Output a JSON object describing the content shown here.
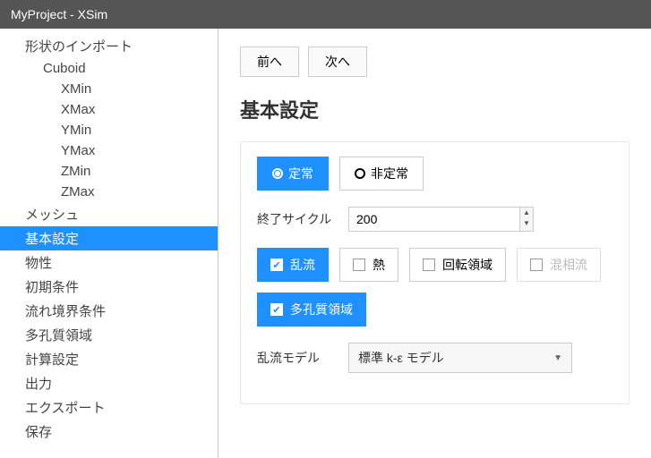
{
  "title": "MyProject - XSim",
  "sidebar": {
    "items": [
      {
        "label": "形状のインポート",
        "lvl": 0,
        "sel": false
      },
      {
        "label": "Cuboid",
        "lvl": 1,
        "sel": false
      },
      {
        "label": "XMin",
        "lvl": 2,
        "sel": false
      },
      {
        "label": "XMax",
        "lvl": 2,
        "sel": false
      },
      {
        "label": "YMin",
        "lvl": 2,
        "sel": false
      },
      {
        "label": "YMax",
        "lvl": 2,
        "sel": false
      },
      {
        "label": "ZMin",
        "lvl": 2,
        "sel": false
      },
      {
        "label": "ZMax",
        "lvl": 2,
        "sel": false
      },
      {
        "label": "メッシュ",
        "lvl": 0,
        "sel": false
      },
      {
        "label": "基本設定",
        "lvl": 0,
        "sel": true
      },
      {
        "label": "物性",
        "lvl": 0,
        "sel": false
      },
      {
        "label": "初期条件",
        "lvl": 0,
        "sel": false
      },
      {
        "label": "流れ境界条件",
        "lvl": 0,
        "sel": false
      },
      {
        "label": "多孔質領域",
        "lvl": 0,
        "sel": false
      },
      {
        "label": "計算設定",
        "lvl": 0,
        "sel": false
      },
      {
        "label": "出力",
        "lvl": 0,
        "sel": false
      },
      {
        "label": "エクスポート",
        "lvl": 0,
        "sel": false
      },
      {
        "label": "保存",
        "lvl": 0,
        "sel": false
      }
    ]
  },
  "nav": {
    "prev": "前へ",
    "next": "次へ"
  },
  "section_title": "基本設定",
  "time_mode": {
    "steady": {
      "label": "定常",
      "selected": true
    },
    "unsteady": {
      "label": "非定常",
      "selected": false
    }
  },
  "end_cycle": {
    "label": "終了サイクル",
    "value": "200"
  },
  "features": {
    "turbulence": {
      "label": "乱流",
      "checked": true,
      "disabled": false
    },
    "heat": {
      "label": "熱",
      "checked": false,
      "disabled": false
    },
    "rotation": {
      "label": "回転領域",
      "checked": false,
      "disabled": false
    },
    "multiphase": {
      "label": "混相流",
      "checked": false,
      "disabled": true
    },
    "porous": {
      "label": "多孔質領域",
      "checked": true,
      "disabled": false
    }
  },
  "turb_model": {
    "label": "乱流モデル",
    "value": "標準 k-ε モデル"
  }
}
